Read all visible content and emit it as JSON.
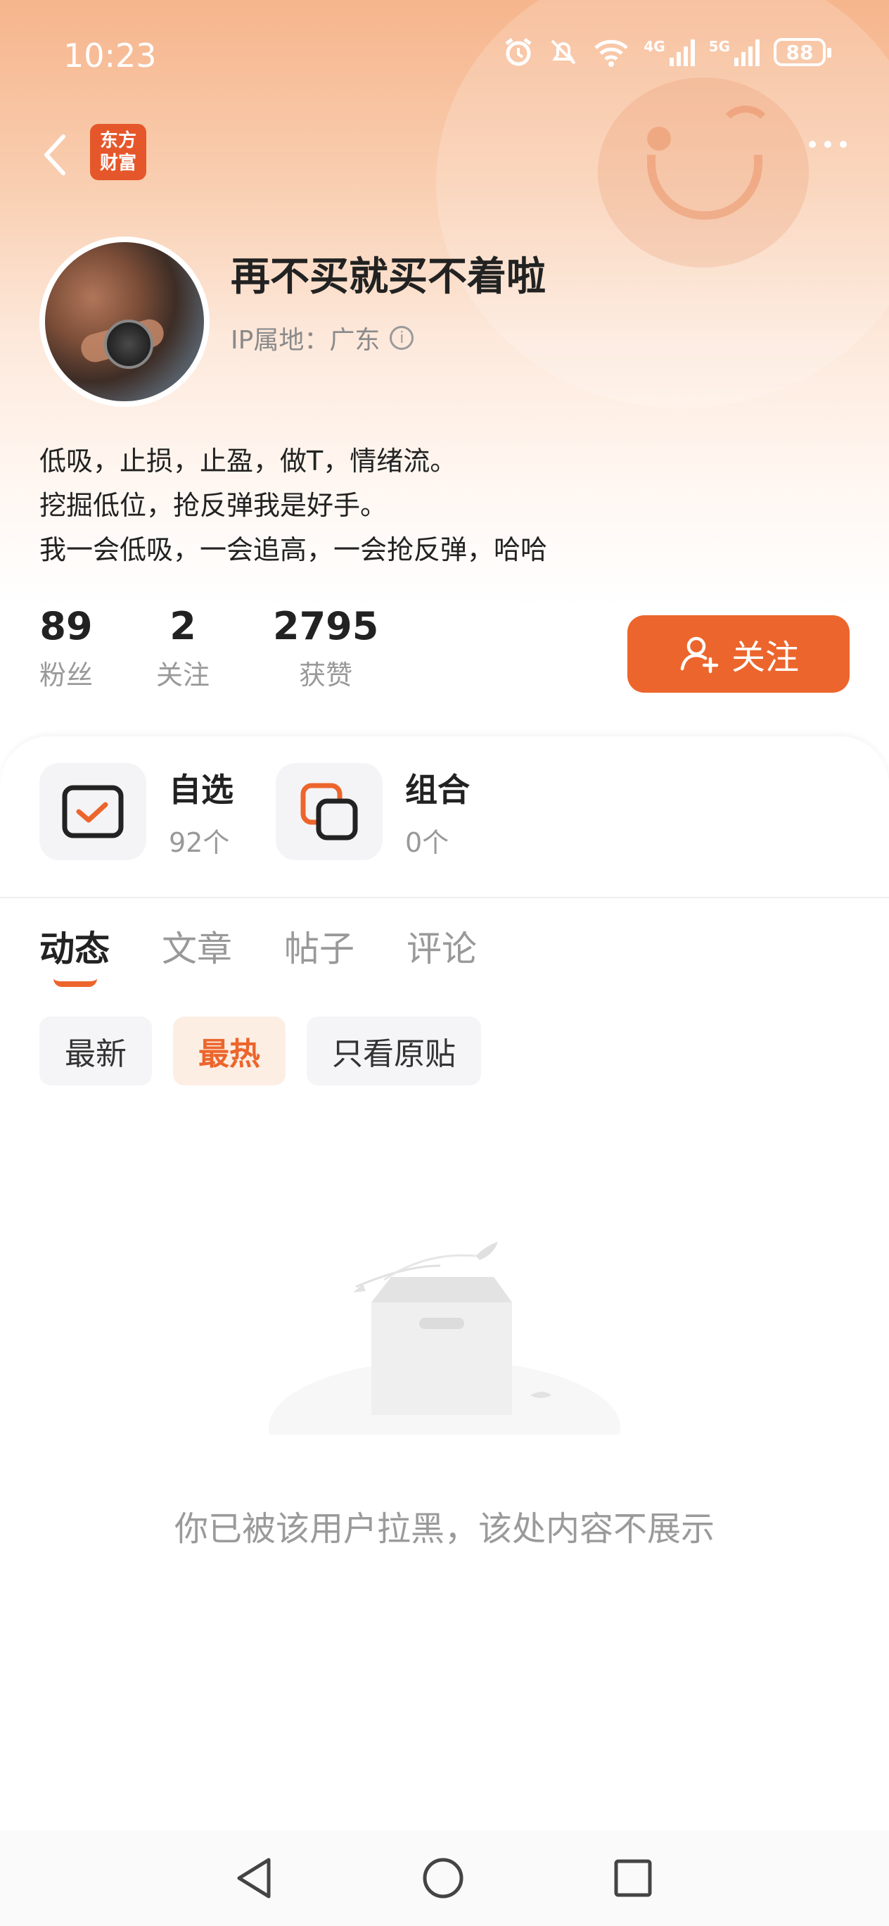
{
  "status_bar": {
    "time": "10:23",
    "battery": "88",
    "net1": "4G",
    "net2": "5G"
  },
  "header": {
    "logo_line1": "东方",
    "logo_line2": "财富"
  },
  "profile": {
    "username": "再不买就买不着啦",
    "ip_label": "IP属地：广东",
    "bio": [
      "低吸，止损，止盈，做T，情绪流。",
      "挖掘低位，抢反弹我是好手。",
      "我一会低吸，一会追高，一会抢反弹，哈哈"
    ]
  },
  "stats": [
    {
      "value": "89",
      "label": "粉丝"
    },
    {
      "value": "2",
      "label": "关注"
    },
    {
      "value": "2795",
      "label": "获赞"
    }
  ],
  "follow_button": "关注",
  "shortcuts": [
    {
      "title": "自选",
      "count": "92个",
      "icon": "checkbox-icon"
    },
    {
      "title": "组合",
      "count": "0个",
      "icon": "portfolio-icon"
    }
  ],
  "tabs": [
    "动态",
    "文章",
    "帖子",
    "评论"
  ],
  "filters": [
    "最新",
    "最热",
    "只看原贴"
  ],
  "empty_message": "你已被该用户拉黑，该处内容不展示",
  "colors": {
    "accent": "#ec652c",
    "header_gradient": "#f6b58c"
  }
}
